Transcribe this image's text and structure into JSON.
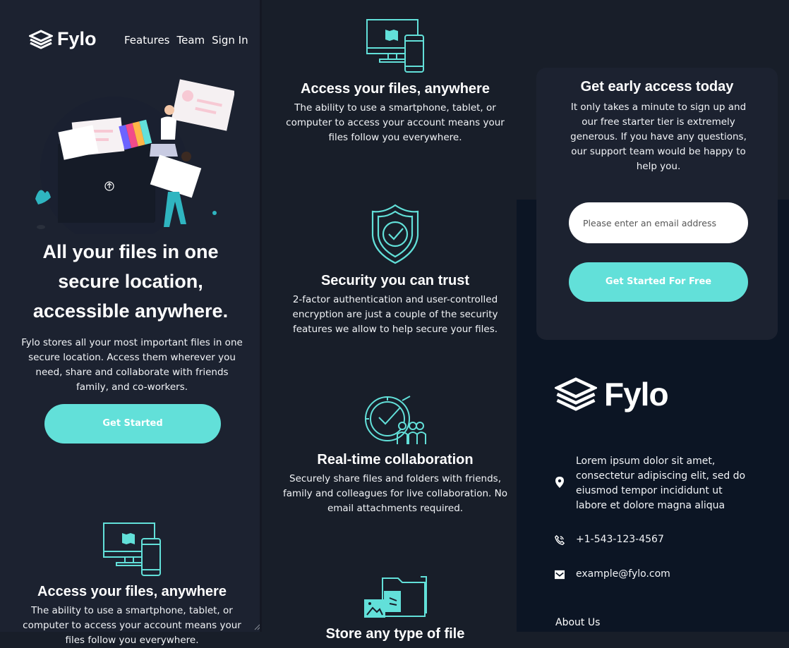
{
  "brand": {
    "name": "Fylo"
  },
  "nav": {
    "features": "Features",
    "team": "Team",
    "sign_in": "Sign In"
  },
  "hero": {
    "title": "All your files in one secure location, accessible anywhere.",
    "text": "Fylo stores all your most important files in one secure location. Access them wherever you need, share and collaborate with friends family, and co-workers.",
    "button": "Get Started"
  },
  "features": [
    {
      "title": "Access your files, anywhere",
      "text": "The ability to use a smartphone, tablet, or computer to access your account means your files follow you everywhere.",
      "icon": "devices-icon"
    },
    {
      "title": "Security you can trust",
      "text": "2-factor authentication and user-controlled encryption are just a couple of the security features we allow to help secure your files.",
      "icon": "shield-check-icon"
    },
    {
      "title": "Real-time collaboration",
      "text": "Securely share files and folders with friends, family and colleagues for live collaboration. No email attachments required.",
      "icon": "collaboration-icon"
    },
    {
      "title": "Store any type of file",
      "icon": "folder-files-icon"
    }
  ],
  "left_feature": {
    "title": "Access your files, anywhere",
    "text": "The ability to use a smartphone, tablet, or computer to access your account means your files follow you everywhere."
  },
  "cta": {
    "title": "Get early access today",
    "text": "It only takes a minute to sign up and our free starter tier is extremely generous. If you have any questions, our support team would be happy to help you.",
    "placeholder": "Please enter an email address",
    "button": "Get Started For Free"
  },
  "footer": {
    "address": "Lorem ipsum dolor sit amet, consectetur adipiscing elit, sed do eiusmod tempor incididunt ut labore et dolore magna aliqua",
    "phone": "+1-543-123-4567",
    "email": "example@fylo.com",
    "about": "About Us"
  },
  "colors": {
    "accent": "#62e0d9",
    "card": "#1c2230",
    "background": "#181e29",
    "footer": "#0c1524"
  }
}
